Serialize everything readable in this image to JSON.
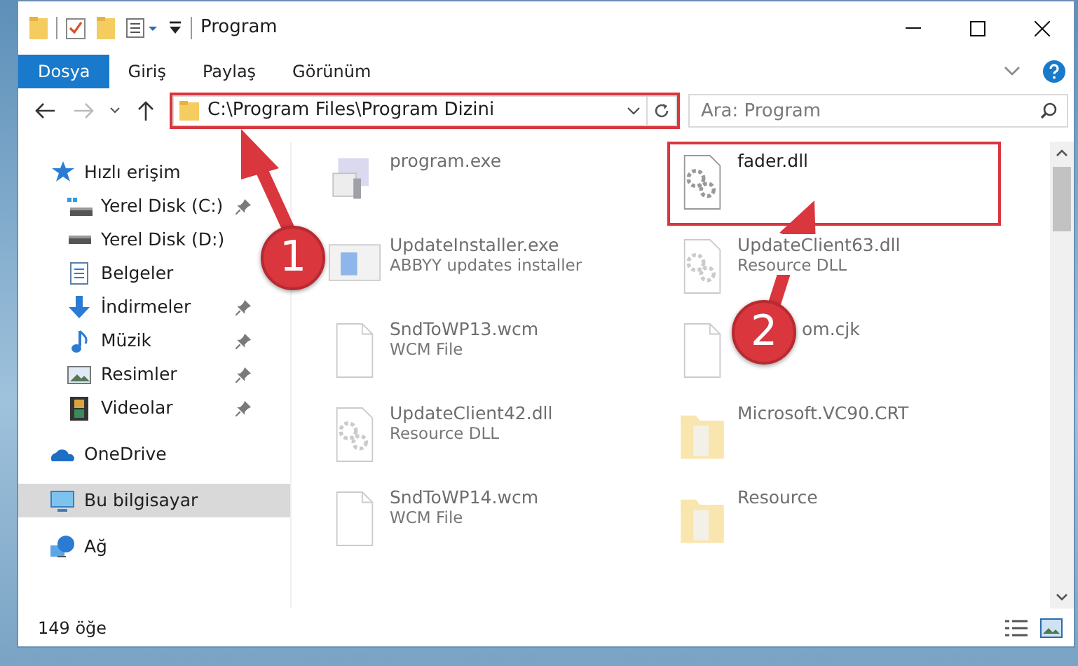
{
  "window": {
    "title": "Program"
  },
  "ribbon_tabs": [
    {
      "label": "Dosya",
      "selected": true
    },
    {
      "label": "Giriş",
      "selected": false
    },
    {
      "label": "Paylaş",
      "selected": false
    },
    {
      "label": "Görünüm",
      "selected": false
    }
  ],
  "address_bar": {
    "path": "C:\\Program Files\\Program Dizini",
    "highlighted": true
  },
  "search": {
    "placeholder": "Ara: Program"
  },
  "navigation": [
    {
      "label": "Hızlı erişim",
      "kind": "star",
      "selected": false,
      "children": [
        {
          "label": "Yerel Disk (C:)",
          "kind": "drive_c",
          "pinned": true,
          "selected": false
        },
        {
          "label": "Yerel Disk (D:)",
          "kind": "drive",
          "pinned": false,
          "selected": false
        },
        {
          "label": "Belgeler",
          "kind": "documents",
          "pinned": false,
          "selected": false
        },
        {
          "label": "İndirmeler",
          "kind": "download",
          "pinned": true,
          "selected": false
        },
        {
          "label": "Müzik",
          "kind": "music",
          "pinned": true,
          "selected": false
        },
        {
          "label": "Resimler",
          "kind": "pictures",
          "pinned": true,
          "selected": false
        },
        {
          "label": "Videolar",
          "kind": "videos",
          "pinned": true,
          "selected": false
        }
      ]
    },
    {
      "label": "OneDrive",
      "kind": "cloud",
      "selected": false
    },
    {
      "label": "Bu bilgisayar",
      "kind": "computer",
      "selected": true
    },
    {
      "label": "Ağ",
      "kind": "network",
      "selected": false
    }
  ],
  "files": [
    {
      "name": "program.exe",
      "kind": "exe",
      "dimmed": true,
      "highlighted": false
    },
    {
      "name": "fader.dll",
      "kind": "dll",
      "dimmed": false,
      "highlighted": true
    },
    {
      "name": "UpdateInstaller.exe",
      "description": "ABBYY updates installer",
      "kind": "installer",
      "dimmed": true,
      "highlighted": false
    },
    {
      "name": "UpdateClient63.dll",
      "description": "Resource DLL",
      "kind": "dll",
      "dimmed": true,
      "highlighted": false
    },
    {
      "name": "SndToWP13.wcm",
      "description": "WCM File",
      "kind": "file",
      "dimmed": true,
      "highlighted": false
    },
    {
      "name": "om.cjk",
      "kind": "file",
      "dimmed": true,
      "highlighted": false
    },
    {
      "name": "UpdateClient42.dll",
      "description": "Resource DLL",
      "kind": "dll",
      "dimmed": true,
      "highlighted": false
    },
    {
      "name": "Microsoft.VC90.CRT",
      "kind": "folder",
      "dimmed": true,
      "highlighted": false
    },
    {
      "name": "SndToWP14.wcm",
      "description": "WCM File",
      "kind": "file",
      "dimmed": true,
      "highlighted": false
    },
    {
      "name": "Resource",
      "kind": "folder",
      "dimmed": true,
      "highlighted": false
    }
  ],
  "status_bar": {
    "item_count": "149 öğe"
  },
  "callouts": [
    {
      "number": "1"
    },
    {
      "number": "2"
    }
  ]
}
